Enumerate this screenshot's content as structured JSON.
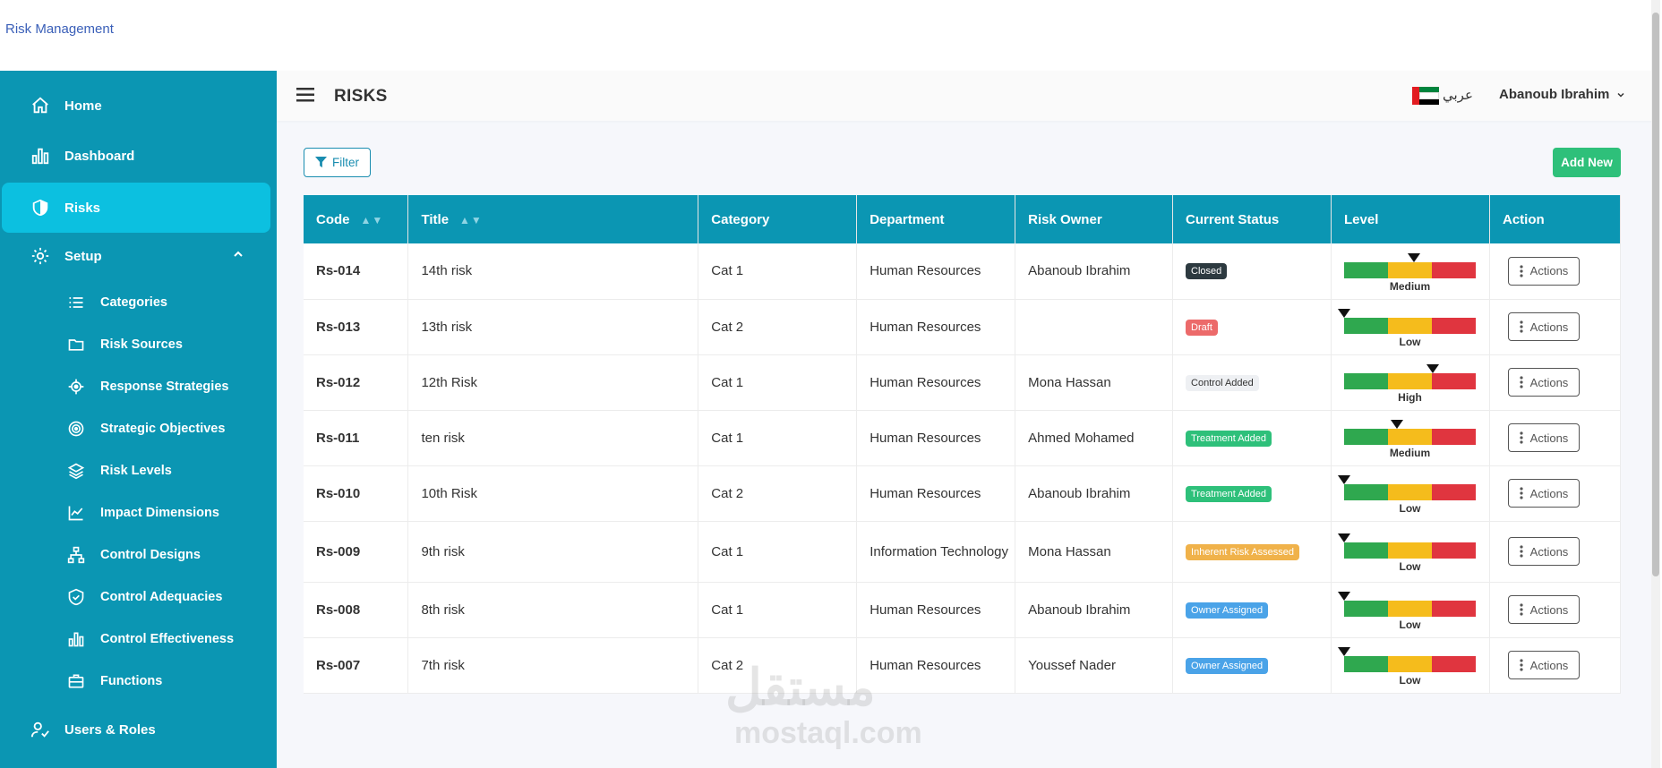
{
  "app": {
    "title": "Risk Management"
  },
  "sidebar": {
    "items": [
      {
        "label": "Home",
        "icon": "home-icon"
      },
      {
        "label": "Dashboard",
        "icon": "bar-chart-icon"
      },
      {
        "label": "Risks",
        "icon": "shield-icon",
        "active": true
      },
      {
        "label": "Setup",
        "icon": "gear-icon",
        "expanded": true
      },
      {
        "label": "Users & Roles",
        "icon": "user-check-icon"
      }
    ],
    "setup_items": [
      {
        "label": "Categories",
        "icon": "list-icon"
      },
      {
        "label": "Risk Sources",
        "icon": "folder-icon"
      },
      {
        "label": "Response Strategies",
        "icon": "crosshair-icon"
      },
      {
        "label": "Strategic Objectives",
        "icon": "target-icon"
      },
      {
        "label": "Risk Levels",
        "icon": "layers-icon"
      },
      {
        "label": "Impact Dimensions",
        "icon": "line-chart-icon"
      },
      {
        "label": "Control Designs",
        "icon": "sitemap-icon"
      },
      {
        "label": "Control Adequacies",
        "icon": "shield-check-icon"
      },
      {
        "label": "Control Effectiveness",
        "icon": "bar-chart-icon"
      },
      {
        "label": "Functions",
        "icon": "briefcase-icon"
      }
    ]
  },
  "header": {
    "title": "RISKS",
    "language": "عربي",
    "user": "Abanoub Ibrahim"
  },
  "toolbar": {
    "filter_label": "Filter",
    "add_label": "Add New"
  },
  "table": {
    "headers": {
      "code": "Code",
      "title": "Title",
      "category": "Category",
      "department": "Department",
      "owner": "Risk Owner",
      "status": "Current Status",
      "level": "Level",
      "action": "Action"
    },
    "action_label": "Actions",
    "rows": [
      {
        "code": "Rs-014",
        "title": "14th risk",
        "category": "Cat 1",
        "department": "Human Resources",
        "owner": "Abanoub Ibrahim",
        "status": "Closed",
        "status_color": "#2d3a40",
        "level": "Medium",
        "level_marker": 0.53
      },
      {
        "code": "Rs-013",
        "title": "13th risk",
        "category": "Cat 2",
        "department": "Human Resources",
        "owner": "",
        "status": "Draft",
        "status_color": "#ec6a6a",
        "level": "Low",
        "level_marker": 0.0
      },
      {
        "code": "Rs-012",
        "title": "12th Risk",
        "category": "Cat 1",
        "department": "Human Resources",
        "owner": "Mona Hassan",
        "status": "Control Added",
        "status_color": "#eef0f3",
        "level": "High",
        "level_marker": 0.67
      },
      {
        "code": "Rs-011",
        "title": "ten risk",
        "category": "Cat 1",
        "department": "Human Resources",
        "owner": "Ahmed Mohamed",
        "status": "Treatment Added",
        "status_color": "#2ec07a",
        "level": "Medium",
        "level_marker": 0.4
      },
      {
        "code": "Rs-010",
        "title": "10th Risk",
        "category": "Cat 2",
        "department": "Human Resources",
        "owner": "Abanoub Ibrahim",
        "status": "Treatment Added",
        "status_color": "#2ec07a",
        "level": "Low",
        "level_marker": 0.0
      },
      {
        "code": "Rs-009",
        "title": "9th risk",
        "category": "Cat 1",
        "department": "Information Technology",
        "owner": "Mona Hassan",
        "status": "Inherent Risk Assessed",
        "status_color": "#f0b24a",
        "level": "Low",
        "level_marker": 0.0
      },
      {
        "code": "Rs-008",
        "title": "8th risk",
        "category": "Cat 1",
        "department": "Human Resources",
        "owner": "Abanoub Ibrahim",
        "status": "Owner Assigned",
        "status_color": "#4aa3e8",
        "level": "Low",
        "level_marker": 0.0
      },
      {
        "code": "Rs-007",
        "title": "7th risk",
        "category": "Cat 2",
        "department": "Human Resources",
        "owner": "Youssef Nader",
        "status": "Owner Assigned",
        "status_color": "#4aa3e8",
        "level": "Low",
        "level_marker": 0.0
      }
    ]
  },
  "colors": {
    "sidebar": "#0b96b3",
    "sidebar_active": "#0cc0e0",
    "level_green": "#2fa84f",
    "level_yellow": "#f5bc1c",
    "level_red": "#e0353f"
  },
  "watermark": {
    "text": "مستقل",
    "sub": "mostaql.com"
  }
}
